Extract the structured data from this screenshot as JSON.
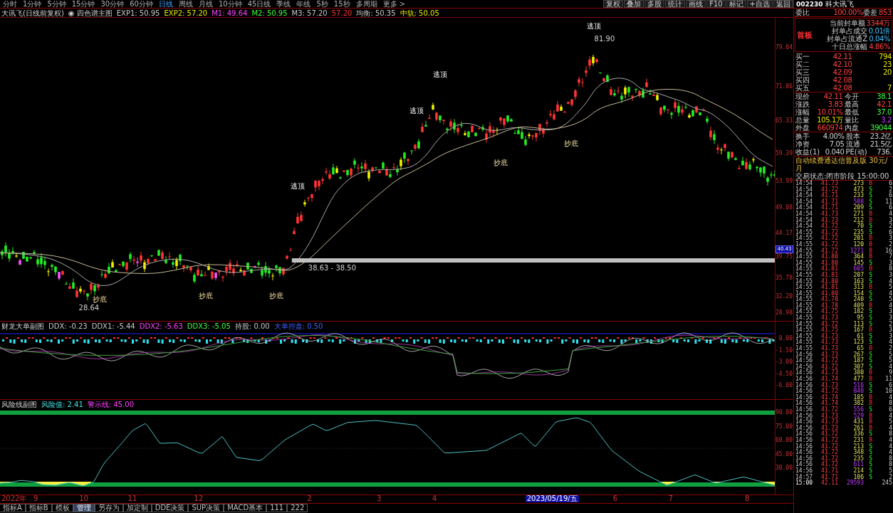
{
  "top_bar": {
    "periods": [
      {
        "label": "分时",
        "selected": false
      },
      {
        "label": "1分钟",
        "selected": false
      },
      {
        "label": "5分钟",
        "selected": false
      },
      {
        "label": "15分钟",
        "selected": false
      },
      {
        "label": "30分钟",
        "selected": false
      },
      {
        "label": "60分钟",
        "selected": false
      },
      {
        "label": "日线",
        "selected": true
      },
      {
        "label": "周线",
        "selected": false
      },
      {
        "label": "月线",
        "selected": false
      },
      {
        "label": "10分钟",
        "selected": false
      },
      {
        "label": "45日线",
        "selected": false
      },
      {
        "label": "季线",
        "selected": false
      },
      {
        "label": "年线",
        "selected": false
      },
      {
        "label": "5秒",
        "selected": false
      },
      {
        "label": "15秒",
        "selected": false
      },
      {
        "label": "多周期",
        "selected": false
      },
      {
        "label": "更多 >",
        "selected": false
      }
    ],
    "tools": [
      "复权",
      "叠加",
      "多股",
      "统计",
      "画线",
      "F10",
      "标记",
      "+自选",
      "返回"
    ]
  },
  "legend": {
    "title": "大讯飞(日线前复权)",
    "indicator": "◉ 四色谱主图",
    "values": [
      {
        "text": "EXP1: 50.95",
        "color": "#c8c8c8"
      },
      {
        "text": "EXP2: 57.20",
        "color": "#e8e800"
      },
      {
        "text": "M1: 49.64",
        "color": "#ff40ff"
      },
      {
        "text": "M2: 50.95",
        "color": "#40ff40"
      },
      {
        "text": "M3: 57.20",
        "color": "#c8c8c8"
      },
      {
        "text": "57.20",
        "color": "#ff3030"
      },
      {
        "text": "均衡: 50.35",
        "color": "#c8c8c8"
      },
      {
        "text": "中轨: 50.05",
        "color": "#e8e800"
      }
    ]
  },
  "main_chart": {
    "axis": [
      "79.04",
      "71.86",
      "65.33",
      "59.39",
      "53.99",
      "49.08",
      "44.17",
      "39.75",
      "35.78",
      "32.20",
      "28.98"
    ],
    "price_tag": "40.43",
    "annotations": [
      {
        "kind": "top",
        "text": "逃顶"
      },
      {
        "kind": "price",
        "text": "81.90"
      },
      {
        "kind": "top",
        "text": "逃顶"
      },
      {
        "kind": "top",
        "text": "逃顶"
      },
      {
        "kind": "top",
        "text": "逃顶"
      },
      {
        "kind": "bottom",
        "text": "抄底"
      },
      {
        "kind": "bottom",
        "text": "抄底"
      },
      {
        "kind": "bottom",
        "text": "抄底"
      },
      {
        "kind": "bottom",
        "text": "抄底"
      },
      {
        "kind": "bottom",
        "text": "抄底"
      },
      {
        "kind": "price",
        "text": "28.64"
      },
      {
        "kind": "price",
        "text": "38.63 - 38.50"
      }
    ]
  },
  "indicator_1": {
    "name": "财龙大单副图",
    "values": [
      {
        "text": "DDX: -0.23",
        "color": "#c8c8c8"
      },
      {
        "text": "DDX1: -5.44",
        "color": "#c8c8c8"
      },
      {
        "text": "DDX2: -5.63",
        "color": "#ff40ff"
      },
      {
        "text": "DDX3: -5.05",
        "color": "#40ff40"
      },
      {
        "text": "持股: 0.00",
        "color": "#c8c8c8"
      },
      {
        "text": "大单控盘: 0.50",
        "color": "#4060ff"
      }
    ],
    "axis": [
      "0.00",
      "-1.50",
      "-3.00",
      "-4.50",
      "-6.00"
    ]
  },
  "indicator_2": {
    "name": "风险线副图",
    "values": [
      {
        "text": "风险值: 2.41",
        "color": "#40e0e0"
      },
      {
        "text": "警示线: 45.00",
        "color": "#ff40ff"
      }
    ],
    "axis": [
      "90.00",
      "75.00",
      "60.00",
      "45.00",
      "30.00"
    ]
  },
  "date_axis": [
    {
      "text": "2022年",
      "selected": false
    },
    {
      "text": "9",
      "selected": false
    },
    {
      "text": "10",
      "selected": false
    },
    {
      "text": "11",
      "selected": false
    },
    {
      "text": "12",
      "selected": false
    },
    {
      "text": "2",
      "selected": false
    },
    {
      "text": "3",
      "selected": false
    },
    {
      "text": "4",
      "selected": false
    },
    {
      "text": "2023/05/19/五",
      "selected": true
    },
    {
      "text": "6",
      "selected": false
    },
    {
      "text": "7",
      "selected": false
    },
    {
      "text": "8",
      "selected": false
    }
  ],
  "bottom_tabs": [
    {
      "label": "指标A",
      "selected": false
    },
    {
      "label": "指标B",
      "selected": false
    },
    {
      "label": "模板",
      "selected": false
    },
    {
      "label": "管理",
      "selected": true
    },
    {
      "label": "另存为",
      "selected": false
    },
    {
      "label": "加定制",
      "selected": false
    },
    {
      "label": "DDE决策",
      "selected": false
    },
    {
      "label": "SUP决策",
      "selected": false
    },
    {
      "label": "MACD基本",
      "selected": false
    },
    {
      "label": "111",
      "selected": false
    },
    {
      "label": "222",
      "selected": false
    }
  ],
  "quote_panel": {
    "code": "002230",
    "name": "科大讯飞",
    "ratio": {
      "label": "委比",
      "value": "100.00%",
      "diff_label": "委差",
      "diff": "853"
    },
    "limit_box": {
      "title": "首板",
      "lines": [
        {
          "label": "当前封单额",
          "value": "3344万",
          "color": "#ff4040"
        },
        {
          "label": "封单占成交",
          "value": "0.01倍",
          "color": "#40c0ff"
        },
        {
          "label": "封单占流通Z",
          "value": "0.04%",
          "color": "#40c0ff"
        },
        {
          "label": "十日总涨幅",
          "value": "4.86%",
          "color": "#ff4040"
        }
      ]
    },
    "order_book": [
      {
        "label": "买一",
        "price": "42.11",
        "volume": "794"
      },
      {
        "label": "买二",
        "price": "42.10",
        "volume": "23"
      },
      {
        "label": "买三",
        "price": "42.09",
        "volume": "20"
      },
      {
        "label": "买四",
        "price": "42.08"
      },
      {
        "label": "买五",
        "price": "42.08",
        "volume": "7"
      }
    ],
    "quote": [
      {
        "label": "现价",
        "value": "42.11",
        "color": "#ff4040"
      },
      {
        "label": "今开",
        "value": "38.1",
        "color": "#40ff40"
      },
      {
        "label": "涨跌",
        "value": "3.83",
        "color": "#ff4040"
      },
      {
        "label": "最高",
        "value": "42.1",
        "color": "#ff4040"
      },
      {
        "label": "涨幅",
        "value": "10.01%",
        "color": "#ff4040"
      },
      {
        "label": "最低",
        "value": "37.0",
        "color": "#40ff40"
      },
      {
        "label": "总量",
        "value": "105.1万",
        "color": "#e8e800"
      },
      {
        "label": "量比",
        "value": "3.2",
        "color": "#c040ff"
      },
      {
        "label": "外盘",
        "value": "660974",
        "color": "#ff4040"
      },
      {
        "label": "内盘",
        "value": "39044",
        "color": "#40ff40"
      }
    ],
    "stats": [
      {
        "label": "换手",
        "value": "4.00%"
      },
      {
        "label": "股本",
        "value": "23.2亿"
      },
      {
        "label": "净资",
        "value": "7.05"
      },
      {
        "label": "流通",
        "value": "21.5亿"
      },
      {
        "label": "收益(1)",
        "value": "0.040"
      },
      {
        "label": "PE(动)",
        "value": "736."
      }
    ],
    "notice": "自动续费通达信普及版 30元/月",
    "status": "交易状态:闭市阶段 15:00:00",
    "trades": [
      {
        "time": "14:54",
        "price": "41.73",
        "volume": "273",
        "flag": "B",
        "count": "6",
        "kind": "buy",
        "big": false
      },
      {
        "time": "14:54",
        "price": "41.72",
        "volume": "473",
        "flag": "S",
        "count": "2",
        "kind": "sell",
        "big": false
      },
      {
        "time": "14:54",
        "price": "41.71",
        "volume": "233",
        "flag": "S",
        "count": "6",
        "kind": "sell",
        "big": false
      },
      {
        "time": "14:54",
        "price": "41.71",
        "volume": "588",
        "flag": "S",
        "count": "11",
        "kind": "sell",
        "big": true
      },
      {
        "time": "14:54",
        "price": "41.71",
        "volume": "209",
        "flag": "S",
        "count": "6",
        "kind": "sell",
        "big": false
      },
      {
        "time": "14:54",
        "price": "41.73",
        "volume": "271",
        "flag": "B",
        "count": "4",
        "kind": "buy",
        "big": false
      },
      {
        "time": "14:54",
        "price": "41.73",
        "volume": "212",
        "flag": "B",
        "count": "3",
        "kind": "buy",
        "big": false
      },
      {
        "time": "14:54",
        "price": "41.72",
        "volume": "70",
        "flag": "S",
        "count": "2",
        "kind": "sell",
        "big": false
      },
      {
        "time": "14:55",
        "price": "41.72",
        "volume": "235",
        "flag": "S",
        "count": "6",
        "kind": "sell",
        "big": false
      },
      {
        "time": "14:55",
        "price": "41.72",
        "volume": "201",
        "flag": "B",
        "count": "3",
        "kind": "buy",
        "big": false
      },
      {
        "time": "14:55",
        "price": "41.72",
        "volume": "120",
        "flag": "B",
        "count": "2",
        "kind": "buy",
        "big": false
      },
      {
        "time": "14:55",
        "price": "41.72",
        "volume": "1271",
        "flag": "B",
        "count": "16",
        "kind": "buy",
        "big": true
      },
      {
        "time": "14:55",
        "price": "41.80",
        "volume": "364",
        "flag": "B",
        "count": "7",
        "kind": "buy",
        "big": false
      },
      {
        "time": "14:55",
        "price": "41.80",
        "volume": "145",
        "flag": "S",
        "count": "3",
        "kind": "sell",
        "big": false
      },
      {
        "time": "14:55",
        "price": "41.81",
        "volume": "605",
        "flag": "B",
        "count": "8",
        "kind": "buy",
        "big": true
      },
      {
        "time": "14:55",
        "price": "41.81",
        "volume": "207",
        "flag": "S",
        "count": "3",
        "kind": "sell",
        "big": false
      },
      {
        "time": "14:55",
        "price": "41.80",
        "volume": "163",
        "flag": "S",
        "count": "4",
        "kind": "sell",
        "big": false
      },
      {
        "time": "14:55",
        "price": "41.81",
        "volume": "313",
        "flag": "B",
        "count": "5",
        "kind": "buy",
        "big": false
      },
      {
        "time": "14:55",
        "price": "41.80",
        "volume": "154",
        "flag": "S",
        "count": "4",
        "kind": "sell",
        "big": false
      },
      {
        "time": "14:55",
        "price": "41.78",
        "volume": "240",
        "flag": "S",
        "count": "5",
        "kind": "sell",
        "big": false
      },
      {
        "time": "14:55",
        "price": "41.78",
        "volume": "409",
        "flag": "B",
        "count": "4",
        "kind": "buy",
        "big": false
      },
      {
        "time": "14:55",
        "price": "41.75",
        "volume": "182",
        "flag": "S",
        "count": "3",
        "kind": "sell",
        "big": false
      },
      {
        "time": "14:55",
        "price": "41.73",
        "volume": "95",
        "flag": "S",
        "count": "3",
        "kind": "sell",
        "big": false
      },
      {
        "time": "14:55",
        "price": "41.72",
        "volume": "113",
        "flag": "S",
        "count": "2",
        "kind": "sell",
        "big": false
      },
      {
        "time": "14:55",
        "price": "41.75",
        "volume": "167",
        "flag": "B",
        "count": "3",
        "kind": "buy",
        "big": false
      },
      {
        "time": "14:55",
        "price": "41.73",
        "volume": "61",
        "flag": "S",
        "count": "3",
        "kind": "sell",
        "big": false
      },
      {
        "time": "14:55",
        "price": "41.73",
        "volume": "123",
        "flag": "S",
        "count": "4",
        "kind": "sell",
        "big": false
      },
      {
        "time": "14:55",
        "price": "41.73",
        "volume": "65",
        "flag": "B",
        "count": "2",
        "kind": "buy",
        "big": false
      },
      {
        "time": "14:56",
        "price": "41.73",
        "volume": "267",
        "flag": "S",
        "count": "5",
        "kind": "sell",
        "big": false
      },
      {
        "time": "14:56",
        "price": "41.72",
        "volume": "187",
        "flag": "S",
        "count": "5",
        "kind": "sell",
        "big": false
      },
      {
        "time": "14:56",
        "price": "41.72",
        "volume": "307",
        "flag": "S",
        "count": "4",
        "kind": "sell",
        "big": false
      },
      {
        "time": "14:56",
        "price": "41.73",
        "volume": "380",
        "flag": "B",
        "count": "9",
        "kind": "buy",
        "big": false
      },
      {
        "time": "14:56",
        "price": "41.74",
        "volume": "477",
        "flag": "B",
        "count": "11",
        "kind": "buy",
        "big": false
      },
      {
        "time": "14:56",
        "price": "41.73",
        "volume": "516",
        "flag": "S",
        "count": "6",
        "kind": "sell",
        "big": true
      },
      {
        "time": "14:56",
        "price": "41.72",
        "volume": "840",
        "flag": "S",
        "count": "10",
        "kind": "sell",
        "big": true
      },
      {
        "time": "14:56",
        "price": "41.74",
        "volume": "185",
        "flag": "B",
        "count": "4",
        "kind": "buy",
        "big": false
      },
      {
        "time": "14:56",
        "price": "41.74",
        "volume": "382",
        "flag": "B",
        "count": "8",
        "kind": "buy",
        "big": false
      },
      {
        "time": "14:56",
        "price": "41.72",
        "volume": "556",
        "flag": "S",
        "count": "6",
        "kind": "sell",
        "big": true
      },
      {
        "time": "14:56",
        "price": "41.73",
        "volume": "529",
        "flag": "B",
        "count": "4",
        "kind": "buy",
        "big": true
      },
      {
        "time": "14:56",
        "price": "41.73",
        "volume": "431",
        "flag": "B",
        "count": "5",
        "kind": "buy",
        "big": false
      },
      {
        "time": "14:56",
        "price": "41.73",
        "volume": "261",
        "flag": "B",
        "count": "4",
        "kind": "buy",
        "big": false
      },
      {
        "time": "14:56",
        "price": "41.72",
        "volume": "336",
        "flag": "S",
        "count": "8",
        "kind": "sell",
        "big": false
      },
      {
        "time": "14:56",
        "price": "41.72",
        "volume": "231",
        "flag": "B",
        "count": "4",
        "kind": "buy",
        "big": false
      },
      {
        "time": "14:56",
        "price": "41.72",
        "volume": "213",
        "flag": "S",
        "count": "4",
        "kind": "sell",
        "big": false
      },
      {
        "time": "14:56",
        "price": "41.72",
        "volume": "348",
        "flag": "S",
        "count": "4",
        "kind": "sell",
        "big": false
      },
      {
        "time": "14:56",
        "price": "41.72",
        "volume": "235",
        "flag": "S",
        "count": "8",
        "kind": "sell",
        "big": false
      },
      {
        "time": "14:56",
        "price": "41.72",
        "volume": "611",
        "flag": "S",
        "count": "8",
        "kind": "sell",
        "big": true
      },
      {
        "time": "14:56",
        "price": "41.71",
        "volume": "214",
        "flag": "S",
        "count": "5",
        "kind": "sell",
        "big": false
      },
      {
        "time": "14:57",
        "price": "41.71",
        "volume": "106",
        "flag": "S",
        "count": "2",
        "kind": "sell",
        "big": false
      },
      {
        "time": "15:00",
        "price": "42.11",
        "volume": "29593",
        "count": "245",
        "kind": "close",
        "big": true
      }
    ]
  }
}
